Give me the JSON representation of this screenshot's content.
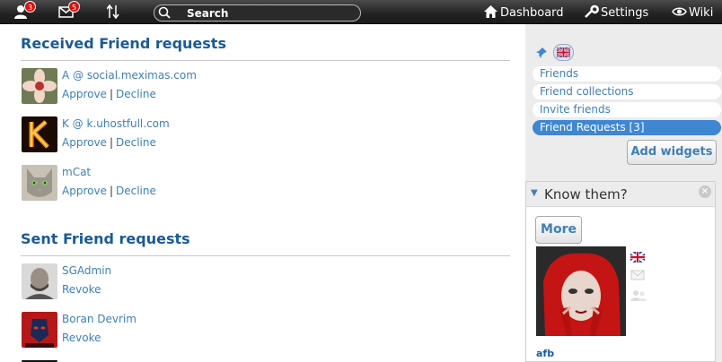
{
  "topbar": {
    "notifications_count": "3",
    "messages_count": "5",
    "search_placeholder": "Search",
    "links": {
      "dashboard": "Dashboard",
      "settings": "Settings",
      "wiki": "Wiki"
    },
    "icons": [
      "contacts-icon",
      "mail-icon",
      "sort-arrows-icon",
      "search-icon",
      "home-icon",
      "wrench-icon",
      "eye-icon"
    ]
  },
  "received": {
    "title": "Received Friend requests",
    "items": [
      {
        "name": "A @ social.meximas.com",
        "approve": "Approve",
        "sep": "|",
        "decline": "Decline"
      },
      {
        "name": "K @ k.uhostfull.com",
        "approve": "Approve",
        "sep": "|",
        "decline": "Decline"
      },
      {
        "name": "mCat",
        "approve": "Approve",
        "sep": "|",
        "decline": "Decline"
      }
    ]
  },
  "sent": {
    "title": "Sent Friend requests",
    "items": [
      {
        "name": "SGAdmin",
        "revoke": "Revoke"
      },
      {
        "name": "Boran Devrim",
        "revoke": "Revoke"
      }
    ]
  },
  "sidebar": {
    "menu": [
      "Friends",
      "Friend collections",
      "Invite friends",
      "Friend Requests [3]"
    ],
    "active_index": 3,
    "add_widgets": "Add widgets",
    "widget": {
      "title": "Know them?",
      "more": "More",
      "user_name": "afb"
    }
  },
  "colors": {
    "link": "#3f7fb8",
    "title": "#1a5a96",
    "active": "#3f86d3",
    "badge": "#d8120f"
  }
}
